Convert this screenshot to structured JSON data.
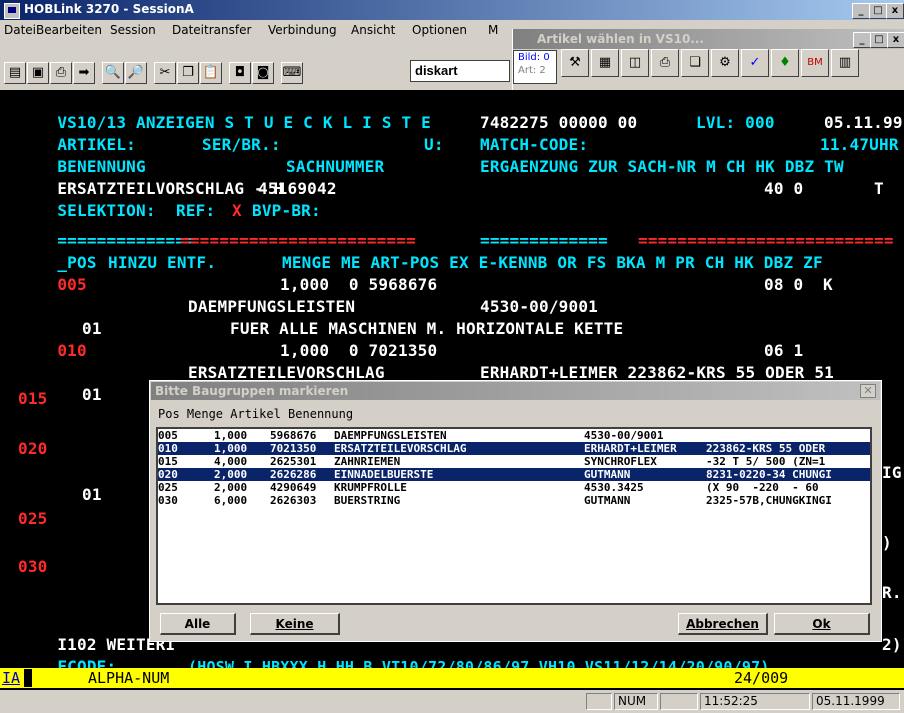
{
  "main_window": {
    "title": "HOBLink 3270 - SessionA"
  },
  "menu": [
    {
      "label": "Datei"
    },
    {
      "label": "Bearbeiten"
    },
    {
      "label": "Session"
    },
    {
      "label": "Dateitransfer"
    },
    {
      "label": "Verbindung"
    },
    {
      "label": "Ansicht"
    },
    {
      "label": "Optionen"
    },
    {
      "label": "M"
    }
  ],
  "toolbar": {
    "combo_value": "diskart"
  },
  "second_window": {
    "title": "Artikel wählen in VS10...",
    "bild": "Bild: 0",
    "art": "Art: 2"
  },
  "terminal": {
    "line1": {
      "a": "VS10/13 ANZEIGEN S T U E C K L I S T E",
      "b": "7482275 00000 00",
      "c": "LVL: 000",
      "d": "05.11.99"
    },
    "line2": {
      "a": "ARTIKEL:",
      "b": "SER/BR.:",
      "c": "U:",
      "d": "MATCH-CODE:",
      "e": "11.47UHR"
    },
    "line3": {
      "a": "BENENNUNG",
      "b": "SACHNUMMER",
      "c": "ERGAENZUNG ZUR SACH-NR M CH HK DBZ TW"
    },
    "line4": {
      "a": "ERSATZTEILVORSCHLAG - H",
      "b": "45169042",
      "c": "40 0",
      "d": "T"
    },
    "line5": {
      "a": "SELEKTION:",
      "b": "REF:",
      "c": "X",
      "d": "BVP-BR:"
    },
    "line7": {
      "a": "==============",
      "b": "========================",
      "c": "=============",
      "d": "=========================="
    },
    "line8": {
      "a": "_POS",
      "b": "HINZU ENTF.",
      "c": "MENGE ME ART-POS EX E-KENNB OR FS BKA M PR CH HK DBZ ZF"
    },
    "pos": [
      "005",
      "010",
      "015",
      "020",
      "025",
      "030"
    ],
    "row005": {
      "a": "1,000  0 5968676",
      "b": "08 0  K"
    },
    "row005b": {
      "a": "DAEMPFUNGSLEISTEN",
      "b": "4530-00/9001"
    },
    "row005c": {
      "a": "01",
      "b": "FUER ALLE MASCHINEN M. HORIZONTALE KETTE"
    },
    "row010": {
      "a": "1,000  0 7021350",
      "b": "06 1"
    },
    "row010b": {
      "a": "ERSATZTEILEVORSCHLAG",
      "b": "ERHARDT+LEIMER 223862-KRS 55 ODER 51"
    },
    "row010c": {
      "a": "01"
    },
    "row020side": {
      "a": "IG"
    },
    "row020c": {
      "a": "01"
    },
    "row025side": {
      "a": ")"
    },
    "row030side": {
      "a": "R."
    },
    "msg": {
      "a": "I102 WEITERI",
      "b": "2)"
    },
    "fcode": {
      "a": "FCODE:",
      "b": "(HOSW,I,HBXXX,H,HH,B,VT10/72/80/86/97,VH10,VS11/12/14/20/90/97)"
    }
  },
  "dialog": {
    "title": "Bitte Baugruppen markieren",
    "header": "Pos Menge Artikel Benennung",
    "items": [
      {
        "pos": "005",
        "menge": "1,000",
        "artikel": "5968676",
        "benennung": "DAEMPFUNGSLEISTEN",
        "erg1": "4530-00/9001",
        "erg2": "",
        "selected": false
      },
      {
        "pos": "010",
        "menge": "1,000",
        "artikel": "7021350",
        "benennung": "ERSATZTEILEVORSCHLAG",
        "erg1": "ERHARDT+LEIMER",
        "erg2": "223862-KRS 55 ODER",
        "selected": true
      },
      {
        "pos": "015",
        "menge": "4,000",
        "artikel": "2625301",
        "benennung": "ZAHNRIEMEN",
        "erg1": "SYNCHROFLEX",
        "erg2": "-32 T 5/ 500 (ZN=1",
        "selected": false
      },
      {
        "pos": "020",
        "menge": "2,000",
        "artikel": "2626286",
        "benennung": "EINNADELBUERSTE",
        "erg1": "GUTMANN",
        "erg2": "8231-0220-34 CHUNGI",
        "selected": true
      },
      {
        "pos": "025",
        "menge": "2,000",
        "artikel": "4290649",
        "benennung": "KRUMPFROLLE",
        "erg1": "4530.3425",
        "erg2": "(X 90  -220  - 60",
        "selected": false
      },
      {
        "pos": "030",
        "menge": "6,000",
        "artikel": "2626303",
        "benennung": "BUERSTRING",
        "erg1": "GUTMANN",
        "erg2": "2325-57B,CHUNGKINGI",
        "selected": false
      }
    ],
    "buttons": {
      "alle": "Alle",
      "keine": "Keine",
      "abbrechen": "Abbrechen",
      "ok": "Ok"
    }
  },
  "statusline": {
    "mode": "IA",
    "type": "ALPHA-NUM",
    "pos": "24/009"
  },
  "statusbar": {
    "num": "NUM",
    "time": "11:52:25",
    "date": "05.11.1999"
  },
  "colors": {
    "cyan": "#00e5ff",
    "white": "#ffffff",
    "red": "#ff2a2a",
    "yellow": "#ffff00",
    "selection": "#0a246a"
  }
}
